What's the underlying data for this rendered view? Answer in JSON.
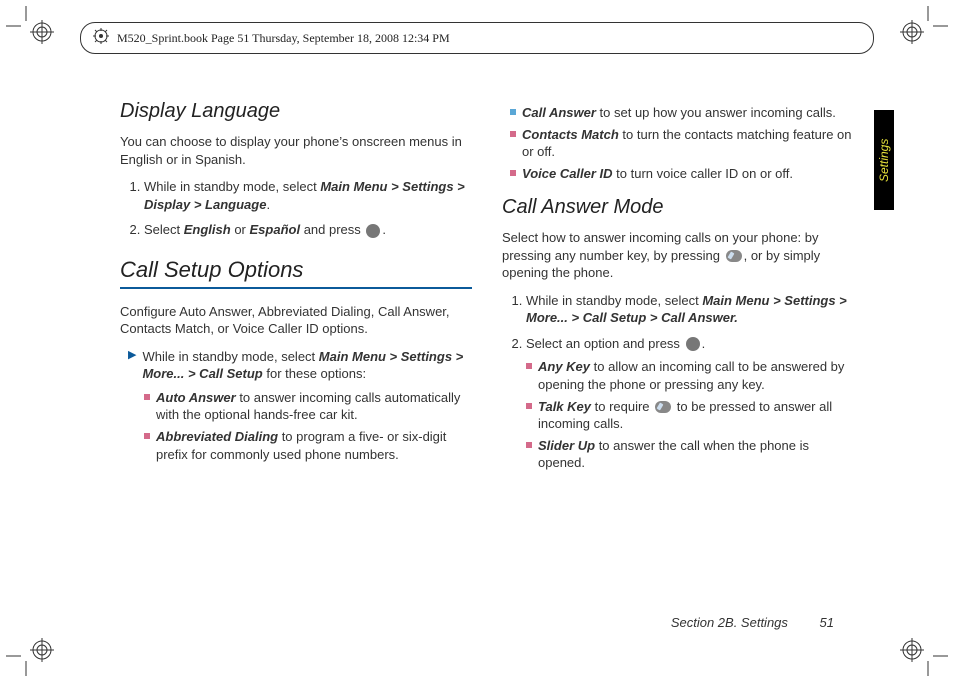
{
  "header": {
    "text": "M520_Sprint.book  Page 51  Thursday, September 18, 2008  12:34 PM"
  },
  "sideTab": "Settings",
  "footer": {
    "section": "Section 2B. Settings",
    "page": "51"
  },
  "left": {
    "h1": "Display Language",
    "p1": "You can choose to display your phone’s onscreen menus in English or in Spanish.",
    "step1_a": "While in standby mode, select ",
    "step1_b": "Main Menu > Settings > Display > Language",
    "step1_c": ".",
    "step2_a": "Select ",
    "step2_b": "English",
    "step2_c": " or ",
    "step2_d": "Español",
    "step2_e": " and press ",
    "step2_f": ".",
    "h2": "Call Setup Options",
    "p2": "Configure Auto Answer, Abbreviated Dialing, Call Answer, Contacts Match, or Voice Caller ID options.",
    "arrow_a": "While in standby mode, select ",
    "arrow_b": "Main Menu > Settings > More... > Call Setup",
    "arrow_c": " for these options:",
    "sub1_a": "Auto Answer",
    "sub1_b": " to answer incoming calls automatically with the optional hands-free car kit.",
    "sub2_a": "Abbreviated Dialing",
    "sub2_b": " to program a five- or six-digit prefix for commonly used phone numbers."
  },
  "right": {
    "sub3_a": "Call Answer",
    "sub3_b": " to set up how you answer incoming calls.",
    "sub4_a": "Contacts Match",
    "sub4_b": " to turn the contacts matching feature on or off.",
    "sub5_a": "Voice Caller ID",
    "sub5_b": " to turn voice caller ID on or off.",
    "h3": "Call Answer Mode",
    "p3_a": "Select how to answer incoming calls on your phone: by pressing any number key, by pressing ",
    "p3_b": ", or by simply opening the phone.",
    "step1_a": "While in standby mode, select ",
    "step1_b": "Main Menu > Settings > More... > Call Setup > Call Answer.",
    "step2_a": "Select an option and press ",
    "step2_b": ".",
    "opt1_a": "Any Key",
    "opt1_b": " to allow an incoming call to be answered by opening the phone or pressing any key.",
    "opt2_a": "Talk Key",
    "opt2_b": " to require ",
    "opt2_c": " to be pressed to answer all incoming calls.",
    "opt3_a": "Slider Up",
    "opt3_b": " to answer the call when the phone is opened."
  }
}
